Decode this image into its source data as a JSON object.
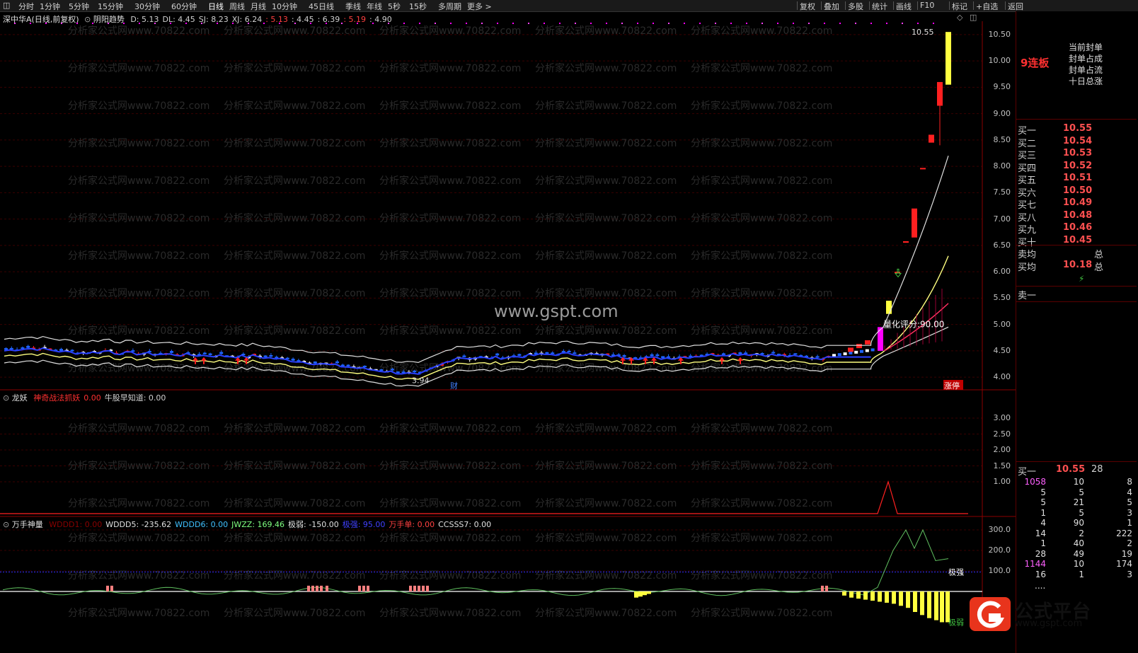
{
  "toolbar": {
    "periods": [
      "分时",
      "1分钟",
      "5分钟",
      "15分钟",
      "30分钟",
      "60分钟",
      "日线",
      "周线",
      "月线",
      "10分钟",
      "45日线",
      "季线",
      "年线",
      "5秒",
      "15秒",
      "多周期",
      "更多 >"
    ],
    "actions": [
      "复权",
      "叠加",
      "多股",
      "统计",
      "画线",
      "F10",
      "标记",
      "+自选",
      "返回"
    ]
  },
  "main_panel": {
    "stock_title": "深中华A(日线,前复权)",
    "indicator_name": "阴阳趋势",
    "indicator_values": [
      {
        "text": "D: 5.13",
        "color": "#d0d0d0"
      },
      {
        "text": "DL: 4.45",
        "color": "#d0d0d0"
      },
      {
        "text": "SJ: 8.23",
        "color": "#d0d0d0"
      },
      {
        "text": "XJ: 6.24",
        "color": "#d0d0d0"
      },
      {
        "text": ": 5.13",
        "color": "#ff4040"
      },
      {
        "text": ": 4.45",
        "color": "#d0d0d0"
      },
      {
        "text": ": 6.39",
        "color": "#d0d0d0"
      },
      {
        "text": ": 5.19",
        "color": "#ff4040"
      },
      {
        "text": ": 4.90",
        "color": "#d0d0d0"
      }
    ],
    "y_axis": [
      "10.50",
      "10.00",
      "9.50",
      "9.00",
      "8.50",
      "8.00",
      "7.50",
      "7.00",
      "6.50",
      "6.00",
      "5.50",
      "5.00",
      "4.50",
      "4.00"
    ],
    "high_label": "10.55",
    "low_label": "3.94",
    "score_label": "量化评分:90.00",
    "cai_label": "财",
    "zhangting_label": "涨停",
    "center_watermark": "www.gspt.com",
    "bg_watermark": "分析家公式网www.70822.com"
  },
  "panel2": {
    "name": "龙妖",
    "items": [
      {
        "text": "神奇战法抓妖",
        "color": "#ff3030"
      },
      {
        "text": "0.00",
        "color": "#ff3030"
      },
      {
        "text": "牛股早知道: 0.00",
        "color": "#d0d0d0"
      }
    ],
    "y_axis": [
      "3.00",
      "2.50",
      "2.00",
      "1.50",
      "1.00"
    ]
  },
  "panel3": {
    "name": "万手神量",
    "items": [
      {
        "text": "WDDD1: 0.00",
        "color": "#8b0000"
      },
      {
        "text": "WDDD5: -235.62",
        "color": "#e0e0e0"
      },
      {
        "text": "WDDD6: 0.00",
        "color": "#40c0ff"
      },
      {
        "text": "JWZZ: 169.46",
        "color": "#80ff80"
      },
      {
        "text": "极弱: -150.00",
        "color": "#e0e0e0"
      },
      {
        "text": "极强: 95.00",
        "color": "#4040ff"
      },
      {
        "text": "万手单: 0.00",
        "color": "#ff4040"
      },
      {
        "text": "CCSSS7: 0.00",
        "color": "#e0e0e0"
      }
    ],
    "y_axis": [
      "300.0",
      "200.0",
      "100.0"
    ],
    "strong_label": "极强",
    "weak_label": "极弱"
  },
  "side_panel": {
    "board_label": "9连板",
    "notes": [
      "当前封单",
      "封单占成",
      "封单占流",
      "十日总涨"
    ],
    "bids": [
      {
        "label": "买一",
        "price": "10.55"
      },
      {
        "label": "买二",
        "price": "10.54"
      },
      {
        "label": "买三",
        "price": "10.53"
      },
      {
        "label": "买四",
        "price": "10.52"
      },
      {
        "label": "买五",
        "price": "10.51"
      },
      {
        "label": "买六",
        "price": "10.50"
      },
      {
        "label": "买七",
        "price": "10.49"
      },
      {
        "label": "买八",
        "price": "10.48"
      },
      {
        "label": "买九",
        "price": "10.46"
      },
      {
        "label": "买十",
        "price": "10.45"
      }
    ],
    "sell_avg_label": "卖均",
    "buy_avg_label": "买均",
    "buy_avg_price": "10.18",
    "zong": "总",
    "sell_one": "卖一",
    "queue_header": {
      "label": "买一",
      "price": "10.55",
      "qty": "28"
    },
    "queue": [
      [
        "1058",
        "10",
        "8"
      ],
      [
        "5",
        "5",
        "4"
      ],
      [
        "5",
        "21",
        "5"
      ],
      [
        "1",
        "5",
        "3"
      ],
      [
        "4",
        "90",
        "1"
      ],
      [
        "14",
        "2",
        "222"
      ],
      [
        "1",
        "40",
        "2"
      ],
      [
        "28",
        "49",
        "19"
      ],
      [
        "1144",
        "10",
        "174"
      ],
      [
        "16",
        "1",
        "3"
      ]
    ],
    "queue_more": "...."
  },
  "logo": {
    "text": "公式平台",
    "url_text": "www.gspt.com"
  },
  "colors": {
    "up": "#ff2020",
    "down": "#1e64ff",
    "grid": "#5a0000",
    "yellow": "#ffff40",
    "magenta": "#ff00ff"
  }
}
